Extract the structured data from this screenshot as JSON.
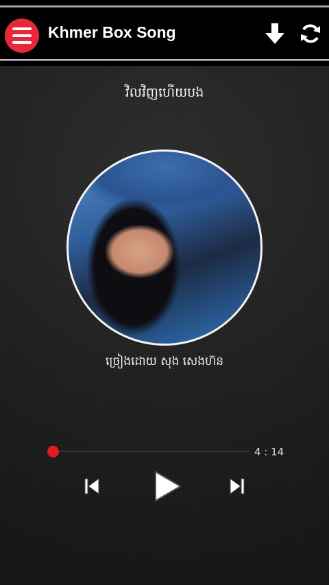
{
  "header": {
    "title": "Khmer Box Song",
    "menu_icon": "hamburger-menu-icon",
    "download_icon": "download-arrow-icon",
    "refresh_icon": "refresh-icon",
    "accent_color": "#e8273a"
  },
  "player": {
    "song_title": "វិលវិញហើយបង",
    "artist": "ច្រៀងដោយ សុង សេងហ៊ន",
    "duration": "4 : 14",
    "progress": 0,
    "controls": {
      "prev_icon": "skip-previous-icon",
      "play_icon": "play-icon",
      "next_icon": "skip-next-icon"
    },
    "progress_color": "#e31b23"
  }
}
